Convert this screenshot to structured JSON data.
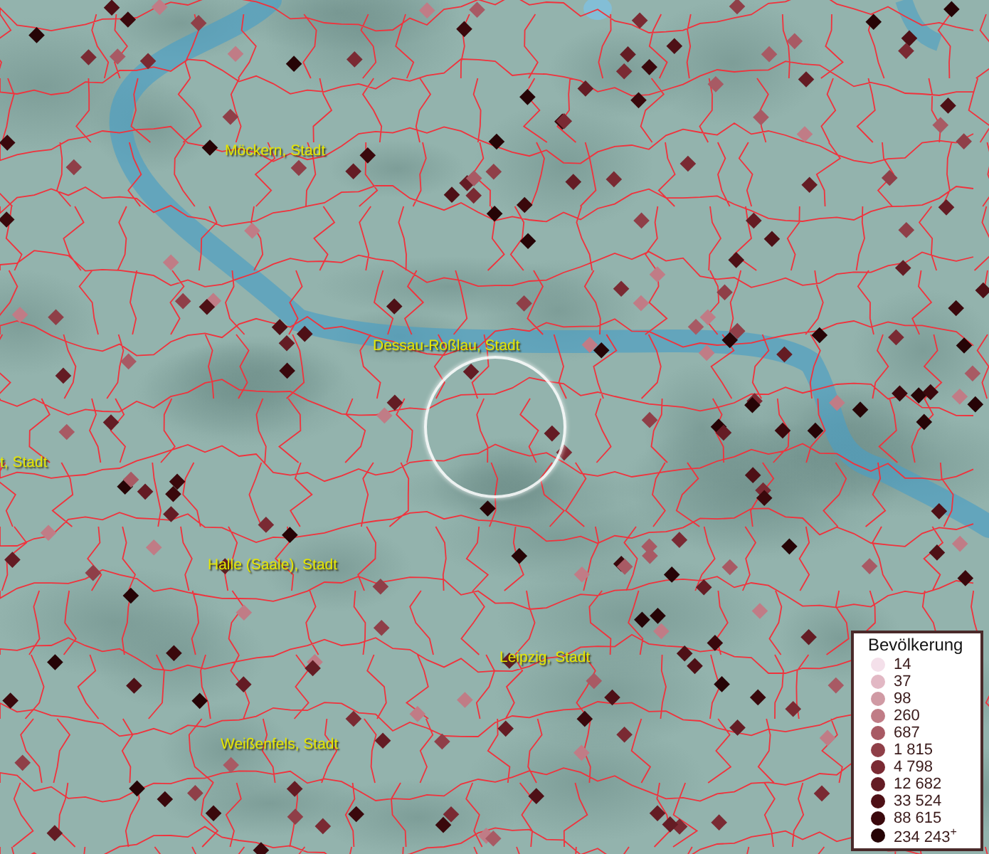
{
  "map": {
    "place_labels": [
      {
        "text": "Möckern, Stadt"
      },
      {
        "text": "Dessau-Roßlau, Stadt"
      },
      {
        "text": "t, Stadt"
      },
      {
        "text": "Halle (Saale), Stadt"
      },
      {
        "text": "Leipzig, Stadt"
      },
      {
        "text": "Weißenfels, Stadt"
      }
    ]
  },
  "legend": {
    "title": "Bevölkerung",
    "items": [
      {
        "label": "14",
        "color": "#f4e0ea"
      },
      {
        "label": "37",
        "color": "#e2b8c4"
      },
      {
        "label": "98",
        "color": "#d09aa4"
      },
      {
        "label": "260",
        "color": "#c07c86"
      },
      {
        "label": "687",
        "color": "#a85a64"
      },
      {
        "label": "1 815",
        "color": "#8f3f48"
      },
      {
        "label": "4 798",
        "color": "#7a2a33"
      },
      {
        "label": "12 682",
        "color": "#641c24"
      },
      {
        "label": "33 524",
        "color": "#4e1016"
      },
      {
        "label": "88 615",
        "color": "#3a080c"
      },
      {
        "label": "234 243$^{+}$",
        "color": "#260406"
      }
    ]
  }
}
